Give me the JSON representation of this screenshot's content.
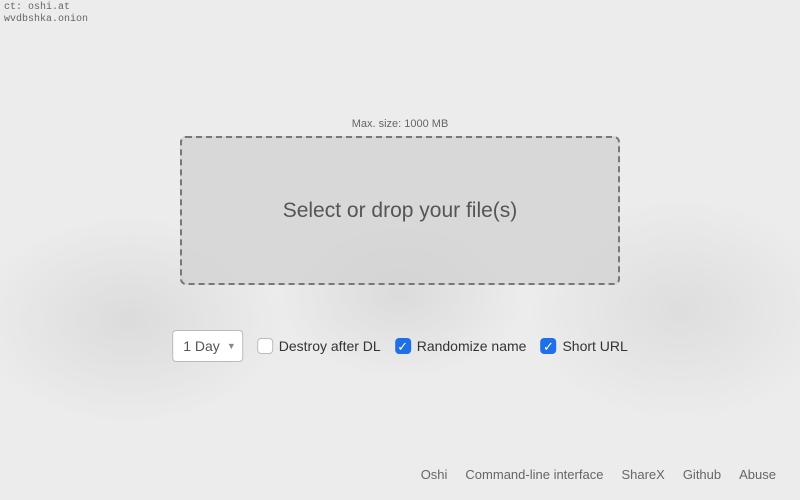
{
  "corner": {
    "line1": "ct: oshi.at",
    "line2": "wvdbshka.onion"
  },
  "upload": {
    "max_size_label": "Max. size: 1000 MB",
    "dropzone_text": "Select or drop your file(s)"
  },
  "options": {
    "expiration_selected": "1 Day",
    "destroy_label": "Destroy after DL",
    "destroy_checked": false,
    "randomize_label": "Randomize name",
    "randomize_checked": true,
    "shorturl_label": "Short URL",
    "shorturl_checked": true
  },
  "footer": {
    "links": [
      "Oshi",
      "Command-line interface",
      "ShareX",
      "Github",
      "Abuse"
    ]
  }
}
